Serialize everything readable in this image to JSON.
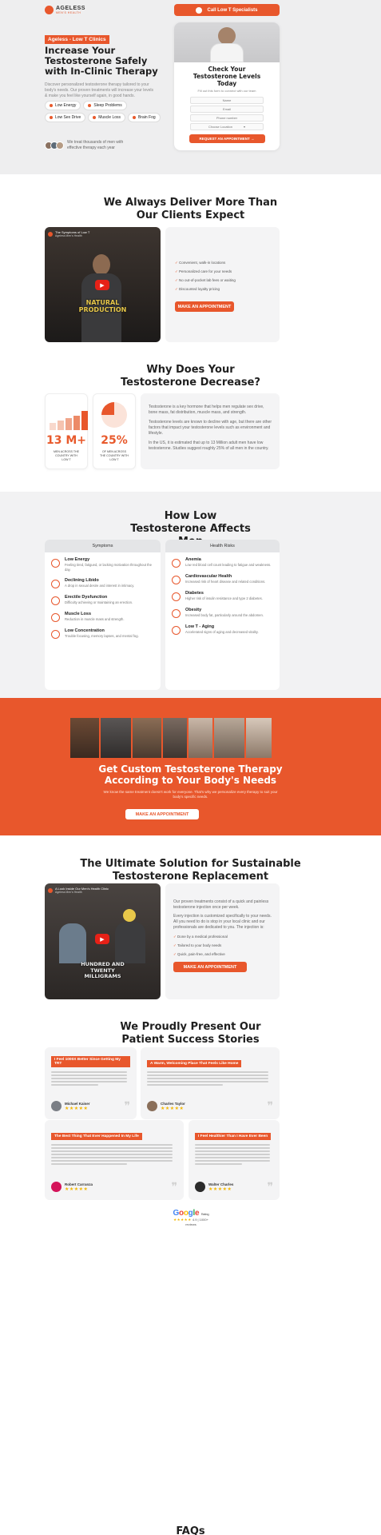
{
  "brand": {
    "name": "AGELESS",
    "tagline": "MEN'S HEALTH"
  },
  "hero": {
    "call_button": "Call Low T Specialists",
    "badge": "Ageless - Low T Clinics",
    "title": "Increase Your Testosterone Safely with In-Clinic Therapy",
    "subtitle": "Discover personalized testosterone therapy tailored to your body's needs. Our proven treatments will increase your levels & make you feel like yourself again, in good hands.",
    "chips": [
      "Low Energy",
      "Sleep Problems",
      "Low Sex Drive",
      "Muscle Loss",
      "Brain Fog"
    ],
    "social_proof": "We treat thousands of men with effective therapy each year"
  },
  "form": {
    "title": "Check Your Testosterone Levels Today",
    "subtitle": "Fill out this form to connect with our team",
    "fields": [
      "Name",
      "Email",
      "Phone number",
      "Choose Location"
    ],
    "submit": "REQUEST AN APPOINTMENT →"
  },
  "deliver": {
    "title": "We Always Deliver More Than Our Clients Expect",
    "video_title": "The Symptoms of Low T",
    "video_channel": "Ageless Men's Health",
    "caption_lines": [
      "NATURAL",
      "PRODUCTION"
    ],
    "checks": [
      "Convenient, walk-in locations",
      "Personalized care for your needs",
      "No out-of-pocket lab fees or waiting",
      "Discounted loyalty pricing"
    ],
    "cta": "MAKE AN APPOINTMENT"
  },
  "why": {
    "title": "Why Does Your Testosterone Decrease?",
    "stat1": {
      "value": "13 M+",
      "label": "MEN ACROSS THE COUNTRY WITH LOW T"
    },
    "stat2": {
      "value": "25%",
      "label": "OF MEN ACROSS THE COUNTRY WITH LOW T"
    },
    "p1": "Testosterone is a key hormone that helps men regulate sex drive, bone mass, fat distribution, muscle mass, and strength.",
    "p2": "Testosterone levels are known to decline with age, but there are other factors that impact your testosterone levels such as environment and lifestyle.",
    "p3": "In the US, it is estimated that up to 13 Million adult men have low testosterone. Studies suggest roughly 25% of all men in the country."
  },
  "affects": {
    "title": "How Low Testosterone Affects Men",
    "col_symptoms": "Symptoms",
    "col_risks": "Health Risks",
    "symptoms": [
      {
        "name": "Low Energy",
        "desc": "Feeling tired, fatigued, or lacking motivation throughout the day."
      },
      {
        "name": "Declining Libido",
        "desc": "A drop in sexual desire and interest in intimacy."
      },
      {
        "name": "Erectile Dysfunction",
        "desc": "Difficulty achieving or maintaining an erection."
      },
      {
        "name": "Muscle Loss",
        "desc": "Reduction in muscle mass and strength."
      },
      {
        "name": "Low Concentration",
        "desc": "Trouble focusing, memory lapses, and mental fog."
      }
    ],
    "risks": [
      {
        "name": "Anemia",
        "desc": "Low red blood cell count leading to fatigue and weakness."
      },
      {
        "name": "Cardiovascular Health",
        "desc": "Increased risk of heart disease and related conditions."
      },
      {
        "name": "Diabetes",
        "desc": "Higher risk of insulin resistance and type 2 diabetes."
      },
      {
        "name": "Obesity",
        "desc": "Increased body fat, particularly around the abdomen."
      },
      {
        "name": "Low T - Aging",
        "desc": "Accelerated signs of aging and decreased vitality."
      }
    ]
  },
  "custom": {
    "title": "Get Custom Testosterone Therapy According to Your Body's Needs",
    "subtitle": "We know the same treatment doesn't work for everyone. That's why we personalize every therapy to suit your body's specific needs.",
    "cta": "MAKE AN APPOINTMENT"
  },
  "ultimate": {
    "title": "The Ultimate Solution for Sustainable Testosterone Replacement",
    "video_title": "A Look Inside Our Men's Health Clinic",
    "video_channel": "Ageless Men's Health",
    "caption_lines": [
      "HUNDRED AND",
      "TWENTY",
      "MILLIGRAMS"
    ],
    "intro": "Our proven treatments consist of a quick and painless testosterone injection once per week.",
    "intro2": "Every injection is customized specifically to your needs. All you need to do is stop in your local clinic and our professionals are dedicated to you. The injection is:",
    "checks": [
      "Done by a medical professional",
      "Tailored to your body needs",
      "Quick, pain-free, and effective"
    ],
    "cta": "MAKE AN APPOINTMENT"
  },
  "stories": {
    "title": "We Proudly Present Our Patient Success Stories",
    "items": [
      {
        "headline": "I Feel 1000X Better Since Getting My TRT",
        "name": "Michael Kaiser",
        "stars": "★★★★★"
      },
      {
        "headline": "A Warm, Welcoming Place That Feels Like Home",
        "name": "Charles Taylor",
        "stars": "★★★★★"
      },
      {
        "headline": "The Best Thing That Ever Happened In My Life",
        "name": "Robert Carranza",
        "stars": "★★★★★"
      },
      {
        "headline": "I Feel Healthier Than I Have Ever Been",
        "name": "Walter Charles",
        "stars": "★★★★★"
      }
    ]
  },
  "rating": {
    "brand": "Google",
    "label": "Rating",
    "score": "★★★★★",
    "count": "4.9 | 1000+ reviews"
  },
  "faqs": {
    "title": "FAQs"
  },
  "colors": {
    "accent": "#e8572c",
    "dark": "#1f1f1f",
    "light_gray": "#f4f4f5"
  }
}
